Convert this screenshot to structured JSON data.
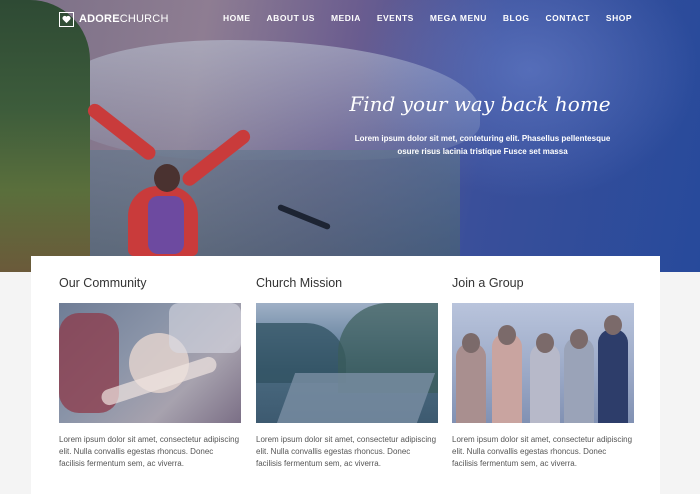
{
  "brand": {
    "name_bold": "ADORE",
    "name_light": "CHURCH",
    "icon": "heart-icon"
  },
  "nav": {
    "items": [
      {
        "label": "HOME"
      },
      {
        "label": "ABOUT US"
      },
      {
        "label": "MEDIA"
      },
      {
        "label": "EVENTS"
      },
      {
        "label": "MEGA MENU"
      },
      {
        "label": "BLOG"
      },
      {
        "label": "CONTACT"
      },
      {
        "label": "SHOP"
      }
    ]
  },
  "hero": {
    "tagline": "Find your way back home",
    "line1": "Lorem ipsum dolor sit met, conteturing elit. Phasellus pellentesque",
    "line2": "osure risus lacinia tristique Fusce set massa"
  },
  "columns": [
    {
      "title": "Our Community",
      "text": "Lorem ipsum dolor sit amet, consectetur adipiscing elit. Nulla convallis egestas rhoncus. Donec facilisis fermentum sem, ac viverra."
    },
    {
      "title": "Church Mission",
      "text": "Lorem ipsum dolor sit amet, consectetur adipiscing elit. Nulla convallis egestas rhoncus. Donec facilisis fermentum sem, ac viverra."
    },
    {
      "title": "Join a Group",
      "text": "Lorem ipsum dolor sit amet, consectetur adipiscing elit. Nulla convallis egestas rhoncus. Donec facilisis fermentum sem, ac viverra."
    }
  ],
  "colors": {
    "text_dark": "#333333",
    "text_body": "#555555",
    "white": "#ffffff",
    "accent_blue": "#274a9b"
  }
}
